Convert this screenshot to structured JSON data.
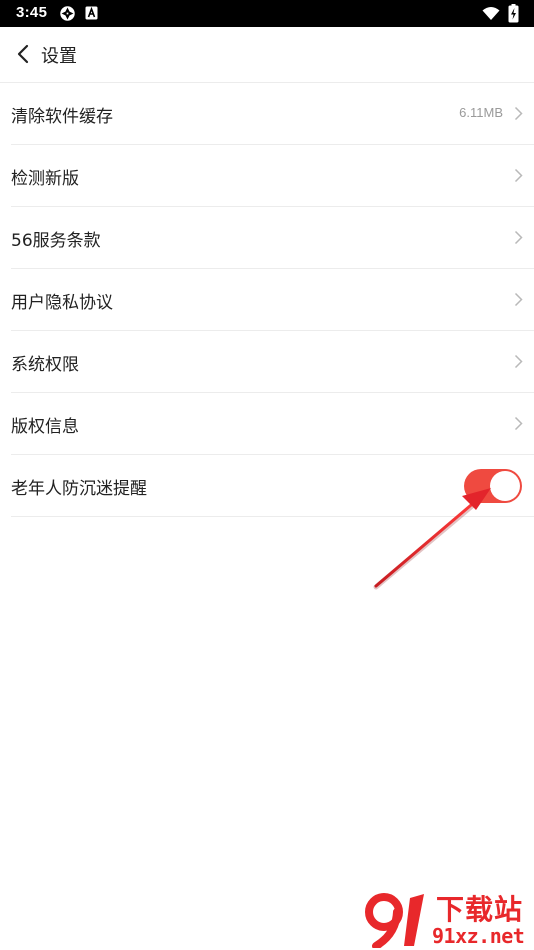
{
  "status_bar": {
    "time": "3:45",
    "icons": [
      "aperture-icon",
      "a-badge-icon",
      "wifi-icon",
      "battery-charging-icon"
    ]
  },
  "header": {
    "title": "设置",
    "back_icon": "chevron-left-icon"
  },
  "settings": {
    "items": [
      {
        "label": "清除软件缓存",
        "value": "6.11MB",
        "control": "chevron"
      },
      {
        "label": "检测新版",
        "control": "chevron"
      },
      {
        "label": "56服务条款",
        "control": "chevron"
      },
      {
        "label": "用户隐私协议",
        "control": "chevron"
      },
      {
        "label": "系统权限",
        "control": "chevron"
      },
      {
        "label": "版权信息",
        "control": "chevron"
      },
      {
        "label": "老年人防沉迷提醒",
        "control": "toggle",
        "toggle_on": true
      }
    ]
  },
  "colors": {
    "accent": "#ef4a40",
    "annotation_arrow": "#e3242b",
    "divider": "#ececec",
    "secondary_text": "#9a9a9a"
  },
  "watermark": {
    "title": "下载站",
    "url": "91xz.net"
  }
}
